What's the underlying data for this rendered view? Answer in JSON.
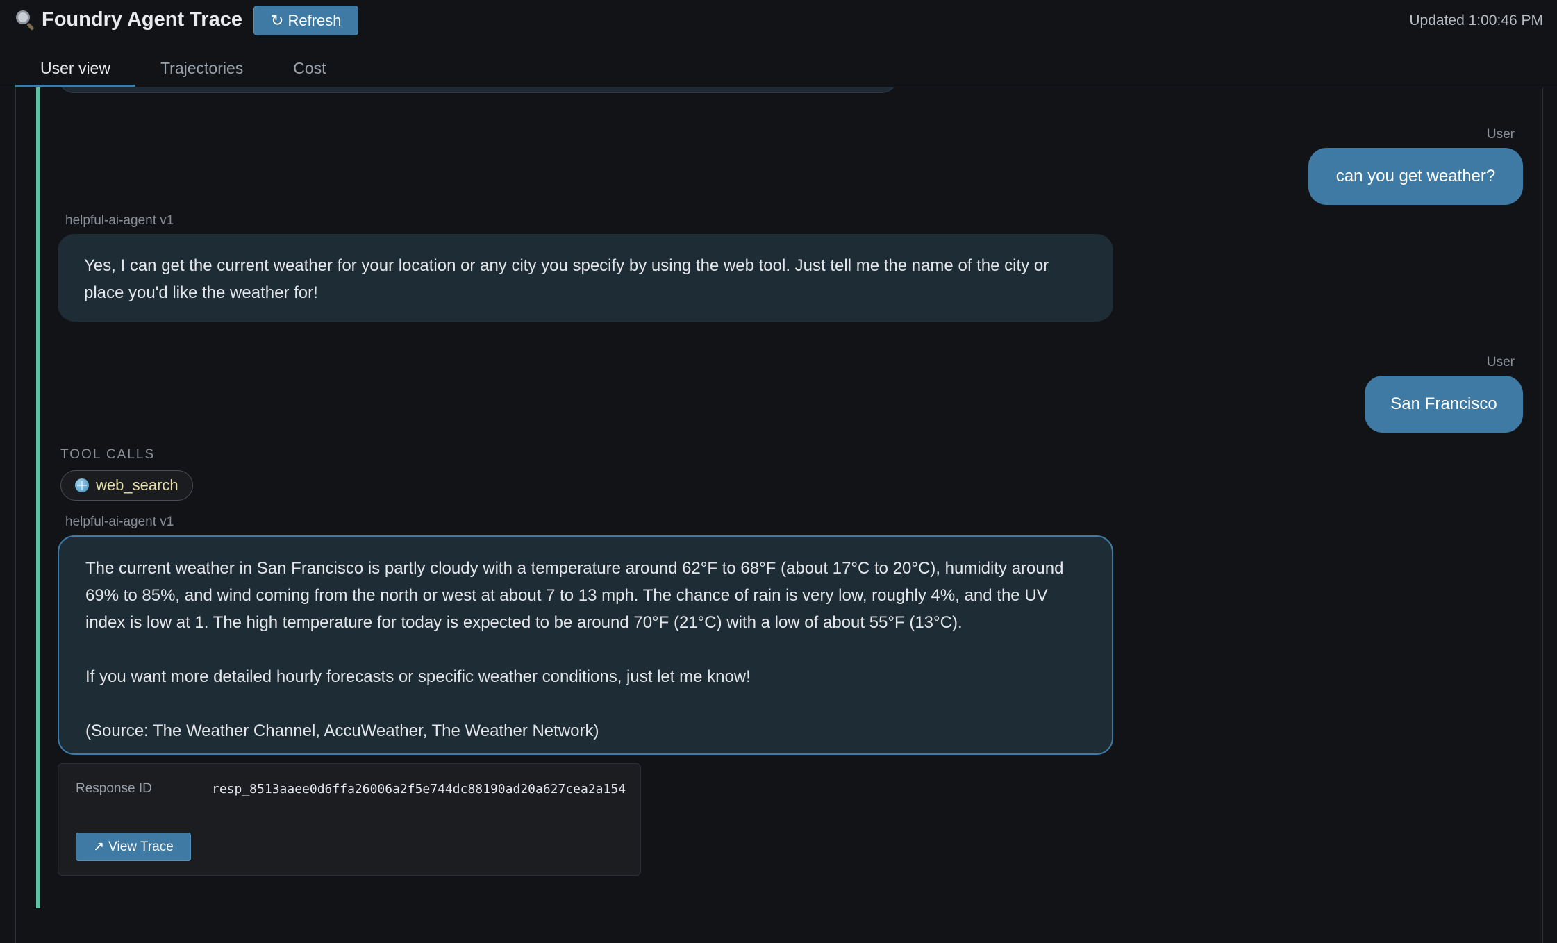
{
  "header": {
    "title": "Foundry Agent Trace",
    "refresh_icon": "↻",
    "refresh_label": "Refresh",
    "updated": "Updated 1:00:46 PM"
  },
  "tabs": [
    {
      "label": "User view",
      "active": true
    },
    {
      "label": "Trajectories",
      "active": false
    },
    {
      "label": "Cost",
      "active": false
    }
  ],
  "conversation": {
    "messages": [
      {
        "role": "User",
        "text": "can you get weather?"
      },
      {
        "role": "helpful-ai-agent v1",
        "text": "Yes, I can get the current weather for your location or any city you specify by using the web tool. Just tell me the name of the city or place you'd like the weather for!"
      },
      {
        "role": "User",
        "text": "San Francisco"
      },
      {
        "role": "helpful-ai-agent v1",
        "paragraphs": [
          "The current weather in San Francisco is partly cloudy with a temperature around 62°F to 68°F (about 17°C to 20°C), humidity around 69% to 85%, and wind coming from the north or west at about 7 to 13 mph. The chance of rain is very low, roughly 4%, and the UV index is low at 1. The high temperature for today is expected to be around 70°F (21°C) with a low of about 55°F (13°C).",
          "If you want more detailed hourly forecasts or specific weather conditions, just let me know!",
          "(Source: The Weather Channel, AccuWeather, The Weather Network)"
        ]
      }
    ],
    "tool_calls": {
      "label": "TOOL CALLS",
      "items": [
        {
          "name": "web_search",
          "icon": "globe-icon"
        }
      ]
    },
    "response_meta": {
      "key": "Response ID",
      "value": "resp_8513aaee0d6ffa26006a2f5e744dc88190ad20a627cea2a154",
      "view_trace_icon": "↗",
      "view_trace_label": "View Trace"
    }
  },
  "colors": {
    "background": "#111316",
    "accent": "#3e7aa3",
    "timeline": "#5cc2a4",
    "agent_bubble": "#1e2c36",
    "tool_text": "#e6dfa8"
  }
}
